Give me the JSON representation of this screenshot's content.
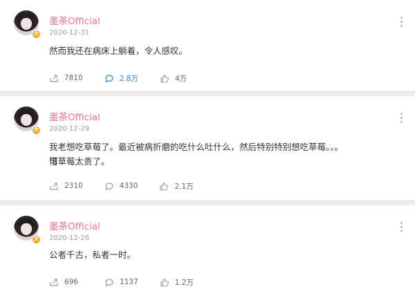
{
  "posts": [
    {
      "author": "墨茶Official",
      "date": "2020-12-31",
      "text": "然而我还在病床上躺着，令人感叹。",
      "repost_count": "7810",
      "comment_count": "2.8万",
      "like_count": "4万",
      "comment_highlighted": true
    },
    {
      "author": "墨茶Official",
      "date": "2020-12-29",
      "text_line1": "我老想吃草莓了。最近被病折磨的吃什么吐什么，然后特别特别想吃草莓。。。可",
      "text_line2": "惜草莓太贵了。",
      "repost_count": "2310",
      "comment_count": "4330",
      "like_count": "2.1万",
      "comment_highlighted": false
    },
    {
      "author": "墨茶Official",
      "date": "2020-12-26",
      "text": "公者千古，私者一时。",
      "repost_count": "696",
      "comment_count": "1137",
      "like_count": "1.2万",
      "comment_highlighted": false
    }
  ],
  "badge_glyph": "大",
  "colors": {
    "author": "#ea6f9a",
    "highlight": "#2a86d6",
    "badge": "#f5a623"
  },
  "icons": [
    "repost-icon",
    "comment-icon",
    "like-icon",
    "more-options-icon"
  ]
}
